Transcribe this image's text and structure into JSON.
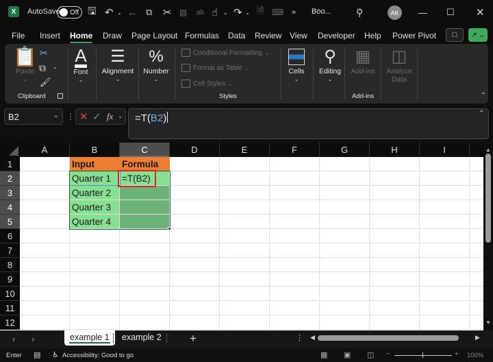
{
  "titlebar": {
    "app_icon": "excel-icon",
    "autosave_label": "AutoSave",
    "autosave_state": "Off",
    "book_title": "Boo...",
    "user_initials": "AK",
    "icons": [
      "save-icon",
      "undo-icon",
      "back-arrow-icon",
      "copy-icon",
      "cut-icon",
      "format-painter-icon",
      "spelling-icon",
      "touch-mode-icon",
      "redo-icon",
      "new-file-icon",
      "keyboard-icon",
      "more-icon",
      "search-icon",
      "minimize-icon",
      "maximize-icon",
      "close-icon"
    ],
    "more_glyph": "»"
  },
  "menu": {
    "items": [
      "File",
      "Insert",
      "Home",
      "Draw",
      "Page Layout",
      "Formulas",
      "Data",
      "Review",
      "View",
      "Developer",
      "Help",
      "Power Pivot"
    ],
    "active": "Home"
  },
  "ribbon": {
    "clipboard": {
      "paste": "Paste",
      "group": "Clipboard"
    },
    "font": {
      "label": "Font"
    },
    "alignment": {
      "label": "Alignment"
    },
    "number": {
      "label": "Number",
      "icon_glyph": "%"
    },
    "styles": {
      "conditional_formatting": "Conditional Formatting",
      "format_as_table": "Format as Table",
      "cell_styles": "Cell Styles",
      "group": "Styles"
    },
    "cells": {
      "label": "Cells"
    },
    "editing": {
      "label": "Editing"
    },
    "addins": {
      "label": "Add-ins",
      "group": "Add-ins"
    },
    "analyze": {
      "label_line1": "Analyze",
      "label_line2": "Data"
    }
  },
  "formula_bar": {
    "name_box": "B2",
    "fx": "fx",
    "formula_prefix": "=T(",
    "formula_ref": "B2",
    "formula_suffix": ")"
  },
  "sheet": {
    "columns": [
      "A",
      "B",
      "C",
      "D",
      "E",
      "F",
      "G",
      "H",
      "I"
    ],
    "rows": [
      "1",
      "2",
      "3",
      "4",
      "5",
      "6",
      "7",
      "8",
      "9",
      "10",
      "11",
      "12"
    ],
    "selected_column": "C",
    "selected_rows": [
      "2",
      "3",
      "4",
      "5"
    ],
    "headers": {
      "B1": "Input",
      "C1": "Formula"
    },
    "inputs": [
      "Quarter 1",
      "Quarter 2",
      "Quarter 3",
      "Quarter 4"
    ],
    "c2_edit": "=T(B2)",
    "colors": {
      "header_fill": "#ed7d31",
      "input_fill": "#87df92",
      "selected_fill": "#6bb178",
      "highlight_border": "#d42828"
    }
  },
  "tabs": {
    "sheets": [
      "example 1",
      "example 2"
    ],
    "active": "example 1",
    "add": "+"
  },
  "status": {
    "mode": "Enter",
    "accessibility": "Accessibility: Good to go",
    "zoom": "100%",
    "zoom_minus": "−",
    "zoom_plus": "+"
  }
}
